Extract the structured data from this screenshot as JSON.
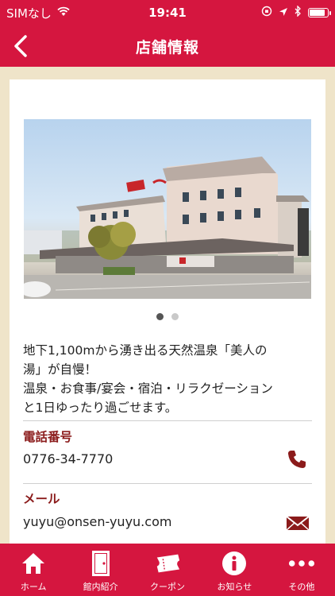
{
  "status": {
    "carrier": "SIMなし",
    "time": "19:41"
  },
  "header": {
    "title": "店舗情報"
  },
  "carousel": {
    "slides": 2,
    "active_index": 0
  },
  "store": {
    "description": "地下1,100mから湧き出る天然温泉「美人の\n湯」が自慢！\n温泉・お食事/宴会・宿泊・リラクゼーション\nと1日ゆったり過ごせます。",
    "phone_label": "電話番号",
    "phone_value": "0776-34-7770",
    "email_label": "メール",
    "email_value": "yuyu@onsen-yuyu.com"
  },
  "tabs": [
    {
      "label": "ホーム",
      "icon": "home-icon"
    },
    {
      "label": "館内紹介",
      "icon": "door-icon"
    },
    {
      "label": "クーポン",
      "icon": "ticket-icon"
    },
    {
      "label": "お知らせ",
      "icon": "info-icon"
    },
    {
      "label": "その他",
      "icon": "more-icon"
    }
  ],
  "colors": {
    "brand_red": "#d5163f",
    "label_brown": "#8b1b1b"
  }
}
